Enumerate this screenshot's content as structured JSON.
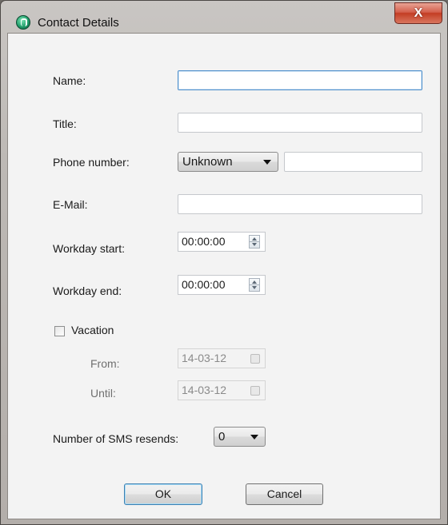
{
  "window": {
    "title": "Contact Details",
    "close_glyph": "X"
  },
  "form": {
    "name": {
      "label": "Name:",
      "value": ""
    },
    "title": {
      "label": "Title:",
      "value": ""
    },
    "phone": {
      "label": "Phone number:",
      "type_selected": "Unknown",
      "value": ""
    },
    "email": {
      "label": "E-Mail:",
      "value": ""
    },
    "workday_start": {
      "label": "Workday start:",
      "value": "00:00:00"
    },
    "workday_end": {
      "label": "Workday end:",
      "value": "00:00:00"
    },
    "vacation": {
      "label": "Vacation",
      "checked": false,
      "from_label": "From:",
      "from_value": "14-03-12",
      "until_label": "Until:",
      "until_value": "14-03-12"
    },
    "sms_resends": {
      "label": "Number of SMS resends:",
      "selected": "0"
    }
  },
  "buttons": {
    "ok": "OK",
    "cancel": "Cancel"
  },
  "icons": {
    "app": "contact-app-icon",
    "close": "close-icon",
    "dropdown": "chevron-down-icon",
    "spinner": "spin-updown-icon",
    "calendar": "calendar-icon"
  }
}
